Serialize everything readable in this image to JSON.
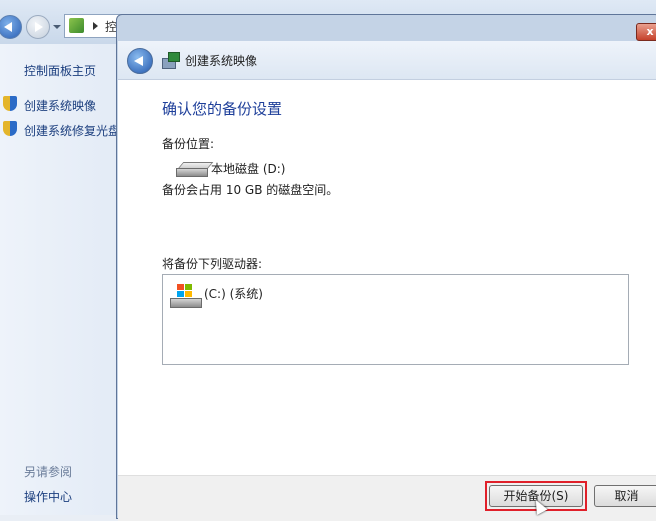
{
  "background_window": {
    "address_text": "控",
    "sidebar": {
      "home": "控制面板主页",
      "items": [
        {
          "label": "创建系统映像"
        },
        {
          "label": "创建系统修复光盘"
        }
      ],
      "see_also": "另请参阅",
      "action_center": "操作中心"
    }
  },
  "dialog": {
    "title": "创建系统映像",
    "close_glyph": "x",
    "heading": "确认您的备份设置",
    "backup_location_label": "备份位置:",
    "backup_location_value": "本地磁盘 (D:)",
    "space_note": "备份会占用 10 GB 的磁盘空间。",
    "drives_label": "将备份下列驱动器:",
    "drives": [
      {
        "label": "(C:) (系统)"
      }
    ],
    "buttons": {
      "start": "开始备份(S)",
      "cancel": "取消"
    }
  },
  "colors": {
    "heading": "#1e3f9a",
    "highlight": "#e0202a",
    "link": "#1b3e7e"
  }
}
